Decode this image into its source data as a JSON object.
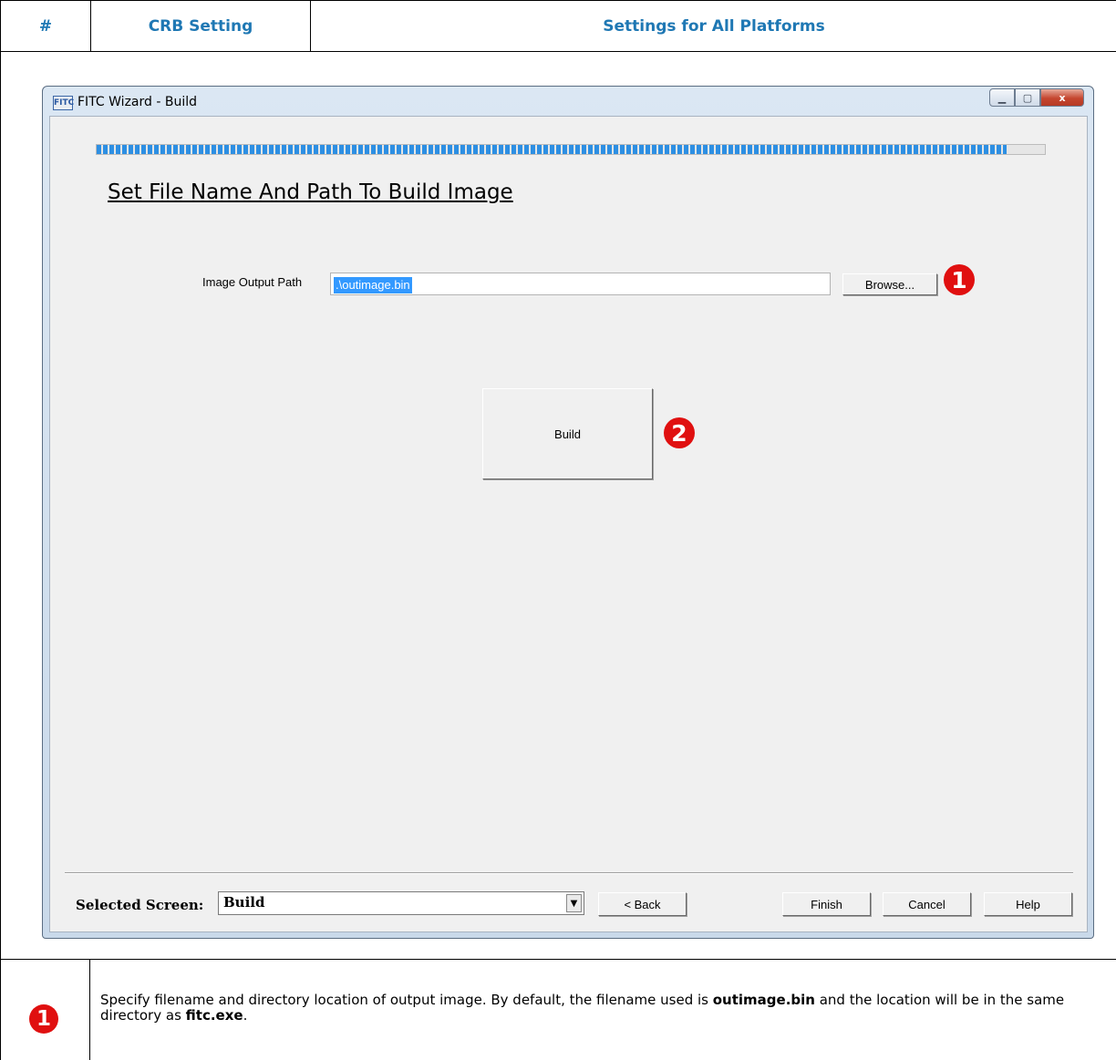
{
  "table": {
    "headers": [
      "#",
      "CRB Setting",
      "Settings for All Platforms"
    ]
  },
  "window": {
    "icon_text": "FITC",
    "title": "FITC Wizard - Build",
    "controls": {
      "minimize_icon": "minimize-icon",
      "maximize_icon": "maximize-icon",
      "close_label": "x"
    }
  },
  "progress": {
    "value": 0.96,
    "color": "#2d8fe3"
  },
  "page": {
    "heading": "Set File Name And Path To Build Image",
    "output_label": "Image Output Path",
    "output_value": ".\\outimage.bin",
    "browse_label": "Browse...",
    "build_label": "Build"
  },
  "footer": {
    "selected_label": "Selected Screen:",
    "selected_value": "Build",
    "back_label": "< Back",
    "finish_label": "Finish",
    "cancel_label": "Cancel",
    "help_label": "Help"
  },
  "callouts": [
    "1",
    "2"
  ],
  "note": {
    "number": "1",
    "text_1": "Specify filename and directory location of output image. By default, the filename used is ",
    "bold_1": "outimage.bin",
    "text_2": " and the location will be in the same directory as ",
    "bold_2": "fitc.exe",
    "text_3": "."
  },
  "colors": {
    "header_text": "#1f78b4",
    "badge": "#e01010",
    "selection": "#3399ff"
  }
}
